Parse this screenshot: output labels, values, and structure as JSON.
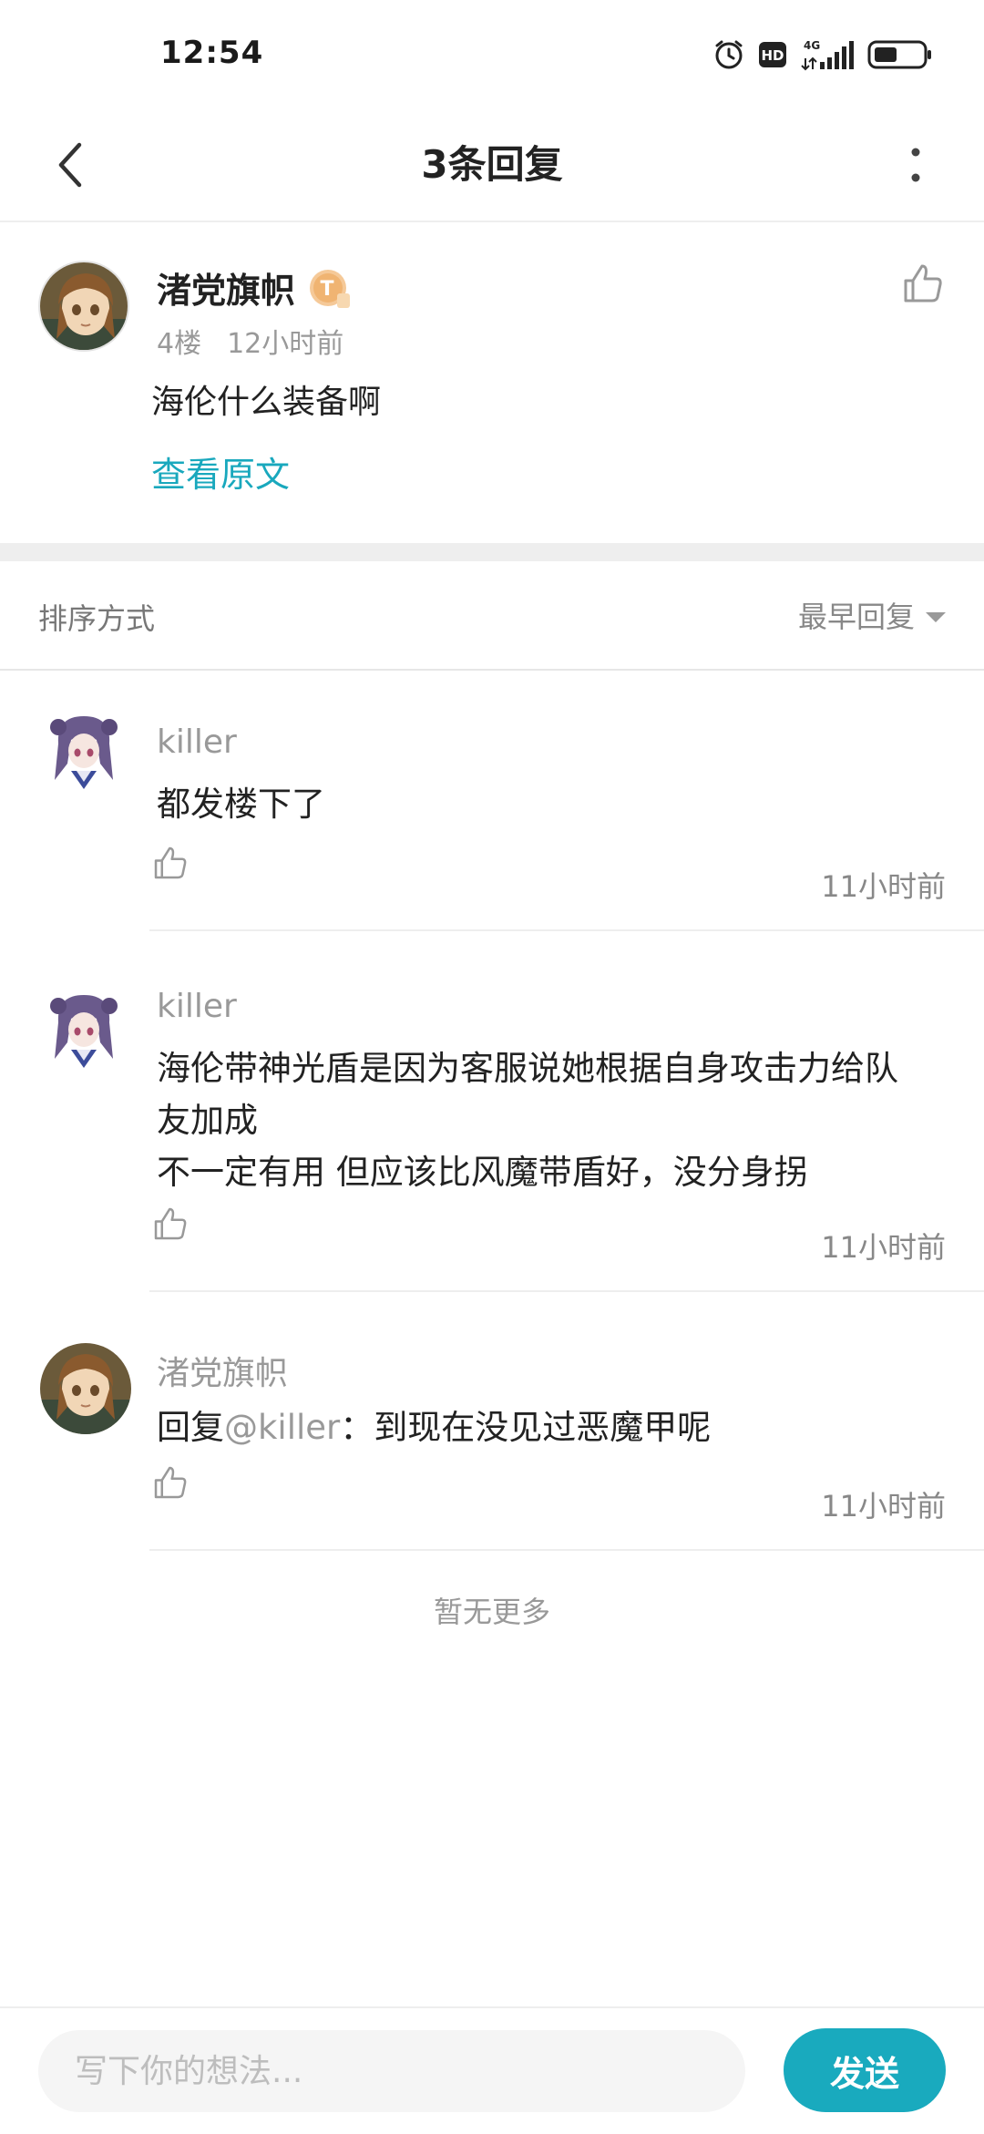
{
  "status_bar": {
    "time": "12:54",
    "network": "4G",
    "hd": "HD",
    "icons": [
      "alarm-icon",
      "hd-icon",
      "signal-icon",
      "battery-icon"
    ]
  },
  "nav": {
    "title": "3条回复",
    "icons": [
      "chevron-left-icon",
      "more-vertical-icon"
    ]
  },
  "original_post": {
    "author": "渚党旗帜",
    "badge_text": "T",
    "floor": "4楼",
    "time": "12小时前",
    "content": "海伦什么装备啊",
    "view_original_label": "查看原文"
  },
  "sort": {
    "label": "排序方式",
    "selected": "最早回复"
  },
  "replies": [
    {
      "author": "killer",
      "content": "都发楼下了",
      "time": "11小时前"
    },
    {
      "author": "killer",
      "content": "海伦带神光盾是因为客服说她根据自身攻击力给队\n友加成\n不一定有用 但应该比风魔带盾好，没分身拐",
      "time": "11小时前"
    },
    {
      "author": "渚党旗帜",
      "reply_prefix": "回复",
      "mention": "@killer",
      "content": "：到现在没见过恶魔甲呢",
      "time": "11小时前"
    }
  ],
  "footer": {
    "no_more": "暂无更多",
    "input_placeholder": "写下你的想法...",
    "send_label": "发送"
  },
  "colors": {
    "accent": "#19a8bd",
    "send_button": "#19aabe",
    "muted_text": "#999999",
    "divider": "#eeeeee"
  }
}
